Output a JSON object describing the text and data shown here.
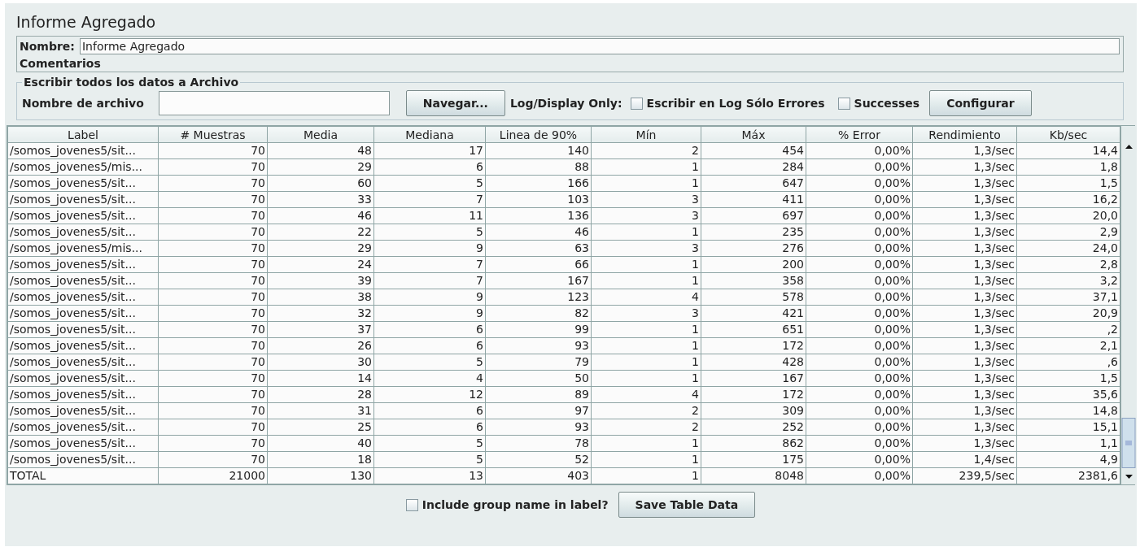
{
  "title": "Informe Agregado",
  "name_field": {
    "label": "Nombre:",
    "value": "Informe Agregado"
  },
  "comments": {
    "label": "Comentarios"
  },
  "file_group": {
    "legend": "Escribir todos los datos a Archivo",
    "filename_label": "Nombre de archivo",
    "browse_button": "Navegar...",
    "log_label": "Log/Display Only:",
    "checkboxes": [
      {
        "label": "Escribir en Log Sólo Errores",
        "checked": false
      },
      {
        "label": "Successes",
        "checked": false
      }
    ],
    "configure_button": "Configurar"
  },
  "table": {
    "columns": [
      "Label",
      "# Muestras",
      "Media",
      "Mediana",
      "Linea de 90%",
      "Mín",
      "Máx",
      "% Error",
      "Rendimiento",
      "Kb/sec"
    ],
    "rows": [
      [
        "/somos_jovenes5/sit...",
        "70",
        "48",
        "17",
        "140",
        "2",
        "454",
        "0,00%",
        "1,3/sec",
        "14,4"
      ],
      [
        "/somos_jovenes5/mis...",
        "70",
        "29",
        "6",
        "88",
        "1",
        "284",
        "0,00%",
        "1,3/sec",
        "1,8"
      ],
      [
        "/somos_jovenes5/sit...",
        "70",
        "60",
        "5",
        "166",
        "1",
        "647",
        "0,00%",
        "1,3/sec",
        "1,5"
      ],
      [
        "/somos_jovenes5/sit...",
        "70",
        "33",
        "7",
        "103",
        "3",
        "411",
        "0,00%",
        "1,3/sec",
        "16,2"
      ],
      [
        "/somos_jovenes5/sit...",
        "70",
        "46",
        "11",
        "136",
        "3",
        "697",
        "0,00%",
        "1,3/sec",
        "20,0"
      ],
      [
        "/somos_jovenes5/sit...",
        "70",
        "22",
        "5",
        "46",
        "1",
        "235",
        "0,00%",
        "1,3/sec",
        "2,9"
      ],
      [
        "/somos_jovenes5/mis...",
        "70",
        "29",
        "9",
        "63",
        "3",
        "276",
        "0,00%",
        "1,3/sec",
        "24,0"
      ],
      [
        "/somos_jovenes5/sit...",
        "70",
        "24",
        "7",
        "66",
        "1",
        "200",
        "0,00%",
        "1,3/sec",
        "2,8"
      ],
      [
        "/somos_jovenes5/sit...",
        "70",
        "39",
        "7",
        "167",
        "1",
        "358",
        "0,00%",
        "1,3/sec",
        "3,2"
      ],
      [
        "/somos_jovenes5/sit...",
        "70",
        "38",
        "9",
        "123",
        "4",
        "578",
        "0,00%",
        "1,3/sec",
        "37,1"
      ],
      [
        "/somos_jovenes5/sit...",
        "70",
        "32",
        "9",
        "82",
        "3",
        "421",
        "0,00%",
        "1,3/sec",
        "20,9"
      ],
      [
        "/somos_jovenes5/sit...",
        "70",
        "37",
        "6",
        "99",
        "1",
        "651",
        "0,00%",
        "1,3/sec",
        ",2"
      ],
      [
        "/somos_jovenes5/sit...",
        "70",
        "26",
        "6",
        "93",
        "1",
        "172",
        "0,00%",
        "1,3/sec",
        "2,1"
      ],
      [
        "/somos_jovenes5/sit...",
        "70",
        "30",
        "5",
        "79",
        "1",
        "428",
        "0,00%",
        "1,3/sec",
        ",6"
      ],
      [
        "/somos_jovenes5/sit...",
        "70",
        "14",
        "4",
        "50",
        "1",
        "167",
        "0,00%",
        "1,3/sec",
        "1,5"
      ],
      [
        "/somos_jovenes5/sit...",
        "70",
        "28",
        "12",
        "89",
        "4",
        "172",
        "0,00%",
        "1,3/sec",
        "35,6"
      ],
      [
        "/somos_jovenes5/sit...",
        "70",
        "31",
        "6",
        "97",
        "2",
        "309",
        "0,00%",
        "1,3/sec",
        "14,8"
      ],
      [
        "/somos_jovenes5/sit...",
        "70",
        "25",
        "6",
        "93",
        "2",
        "252",
        "0,00%",
        "1,3/sec",
        "15,1"
      ],
      [
        "/somos_jovenes5/sit...",
        "70",
        "40",
        "5",
        "78",
        "1",
        "862",
        "0,00%",
        "1,3/sec",
        "1,1"
      ],
      [
        "/somos_jovenes5/sit...",
        "70",
        "18",
        "5",
        "52",
        "1",
        "175",
        "0,00%",
        "1,4/sec",
        "4,9"
      ],
      [
        "TOTAL",
        "21000",
        "130",
        "13",
        "403",
        "1",
        "8048",
        "0,00%",
        "239,5/sec",
        "2381,6"
      ]
    ]
  },
  "footer": {
    "checkbox": {
      "label": "Include group name in label?",
      "checked": false
    },
    "save_button": "Save Table Data"
  }
}
